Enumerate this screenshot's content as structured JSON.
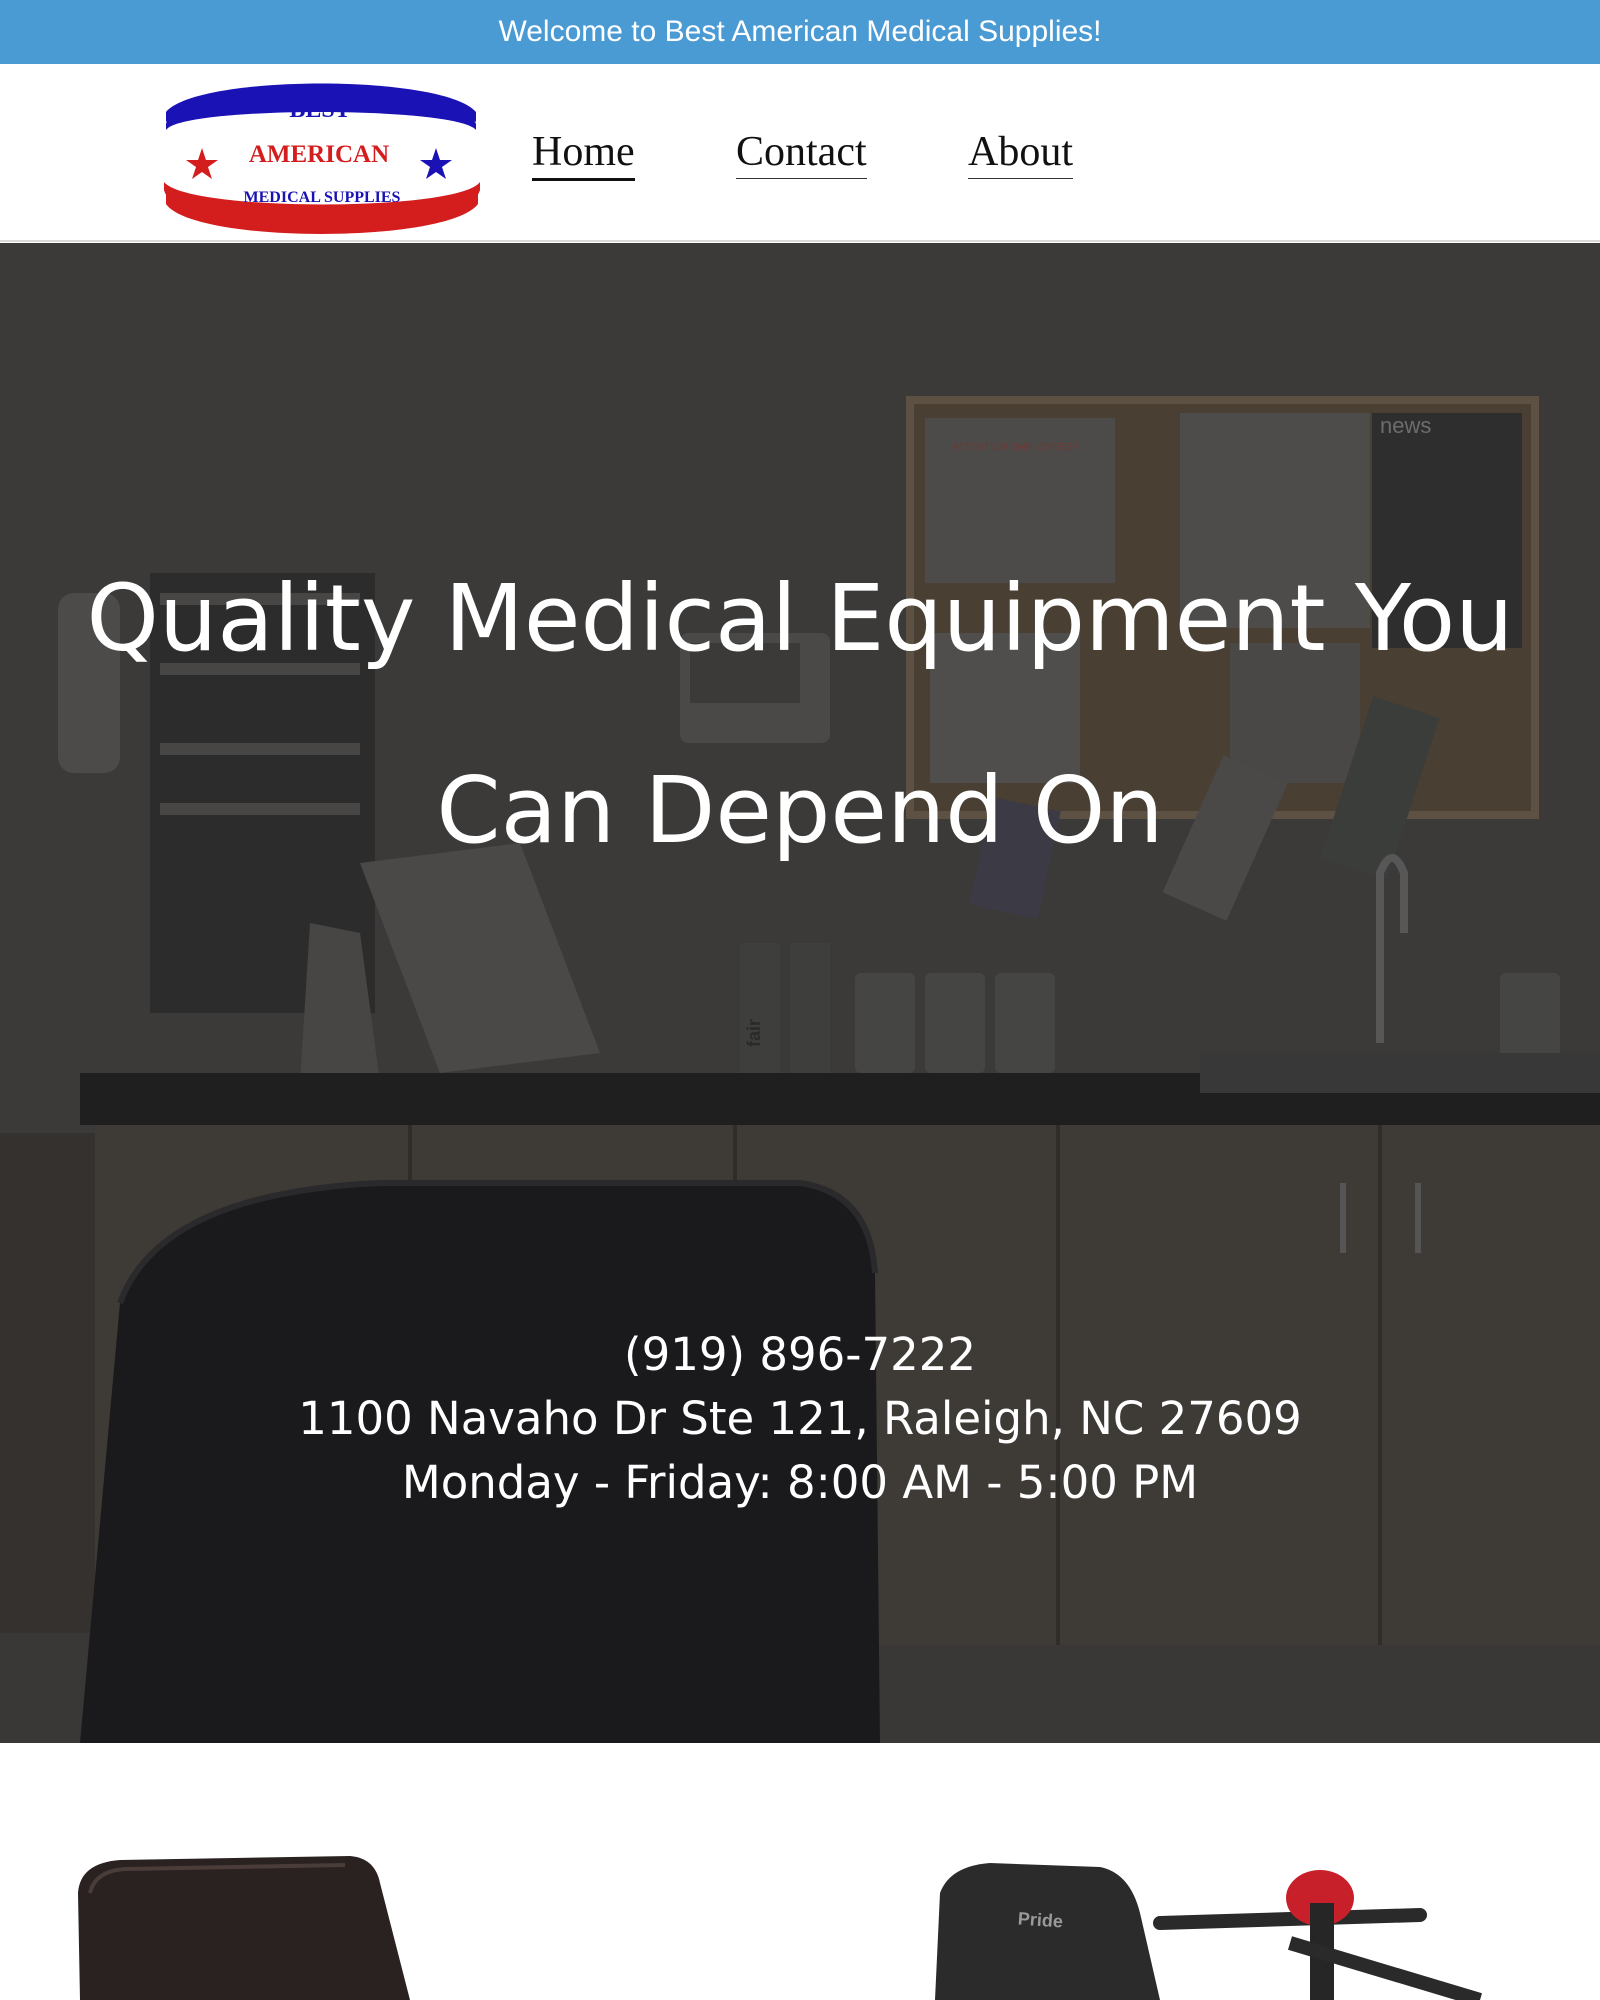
{
  "announcement": {
    "text": "Welcome to Best American Medical Supplies!"
  },
  "logo": {
    "line1": "BEST",
    "line2": "AMERICAN",
    "line3": "MEDICAL SUPPLIES"
  },
  "nav": {
    "items": [
      {
        "label": "Home",
        "active": true
      },
      {
        "label": "Contact",
        "active": false
      },
      {
        "label": "About",
        "active": false
      }
    ]
  },
  "hero": {
    "title_line1": "Quality Medical Equipment You",
    "title_line2": "Can Depend On",
    "phone": "(919) 896-7222",
    "address": "1100 Navaho Dr Ste 121, Raleigh, NC 27609",
    "hours": "Monday - Friday: 8:00 AM - 5:00 PM",
    "scene": {
      "bulletin_heading": "ATTENTION EMPLOYEES!!",
      "news_label": "news",
      "bottle_label": "fair"
    }
  },
  "products": {
    "scooter_brand": "Pride"
  },
  "colors": {
    "announcement_bg": "#4a9ad4",
    "logo_blue": "#1a12b5",
    "logo_red": "#d41e1e"
  }
}
